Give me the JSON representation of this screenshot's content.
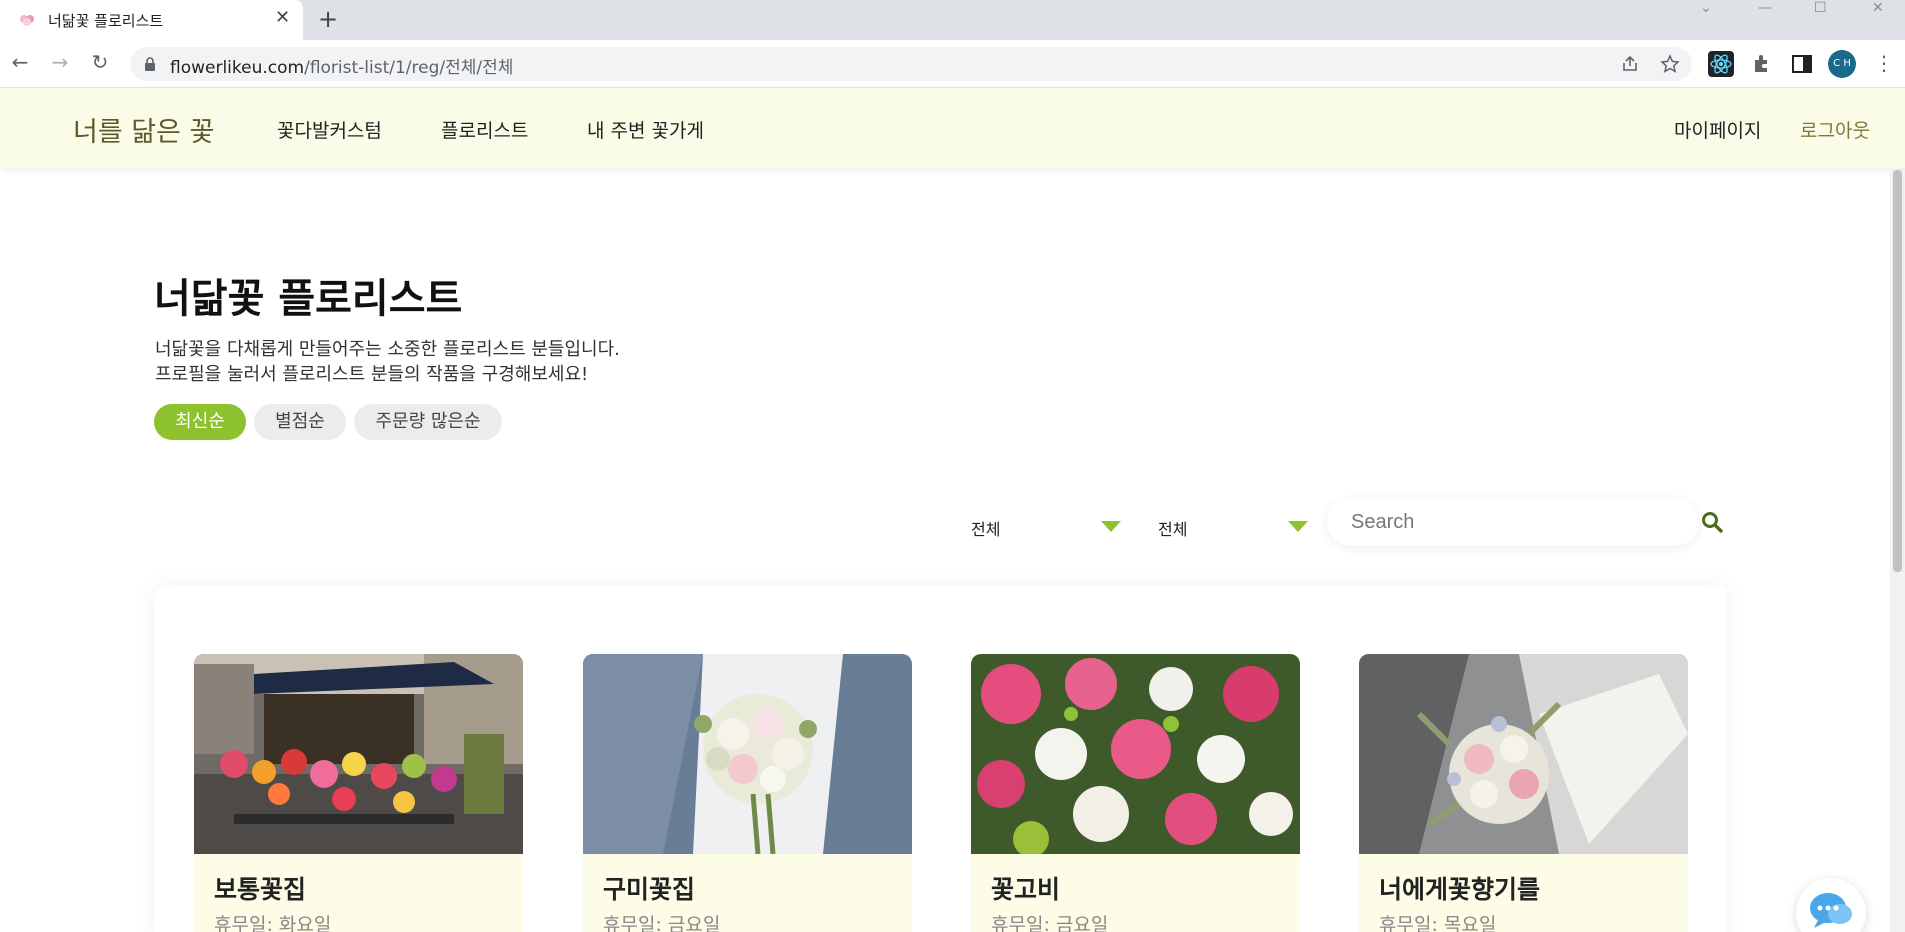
{
  "browser": {
    "tab_title": "너닮꽃 플로리스트",
    "url_host": "flowerlikeu.com",
    "url_path": "/florist-list/1/reg/전체/전체",
    "profile_initials": "C H",
    "icons": [
      "back-icon",
      "forward-icon",
      "reload-icon",
      "lock-icon",
      "share-icon",
      "star-icon",
      "react-devtools-icon",
      "extensions-icon",
      "side-panel-icon",
      "menu-icon"
    ]
  },
  "header": {
    "logo": "너를 닮은 꽃",
    "nav": [
      "꽃다발커스텀",
      "플로리스트",
      "내 주변 꽃가게"
    ],
    "mypage": "마이페이지",
    "logout": "로그아웃",
    "colors": {
      "background": "#fbfce8",
      "logout": "#7a7a3a"
    }
  },
  "page": {
    "title": "너닮꽃 플로리스트",
    "description_1": "너닮꽃을 다채롭게 만들어주는 소중한 플로리스트 분들입니다.",
    "description_2": "프로필을 눌러서 플로리스트 분들의 작품을 구경해보세요!",
    "sort_options": [
      "최신순",
      "별점순",
      "주문량 많은순"
    ],
    "sort_selected": "최신순",
    "accent_color": "#8dc22e"
  },
  "filters": {
    "region_1": "전체",
    "region_2": "전체",
    "search_placeholder": "Search",
    "search_value": ""
  },
  "florists": [
    {
      "name": "보통꽃집",
      "holiday": "휴무일: 화요일",
      "image": "flower-shop-storefront"
    },
    {
      "name": "구미꽃집",
      "holiday": "휴무일: 금요일",
      "image": "bridal-bouquet"
    },
    {
      "name": "꽃고비",
      "holiday": "휴무일: 금요일",
      "image": "pink-rose-bouquet"
    },
    {
      "name": "너에게꽃향기를",
      "holiday": "휴무일: 목요일",
      "image": "wrapped-bouquet"
    }
  ]
}
